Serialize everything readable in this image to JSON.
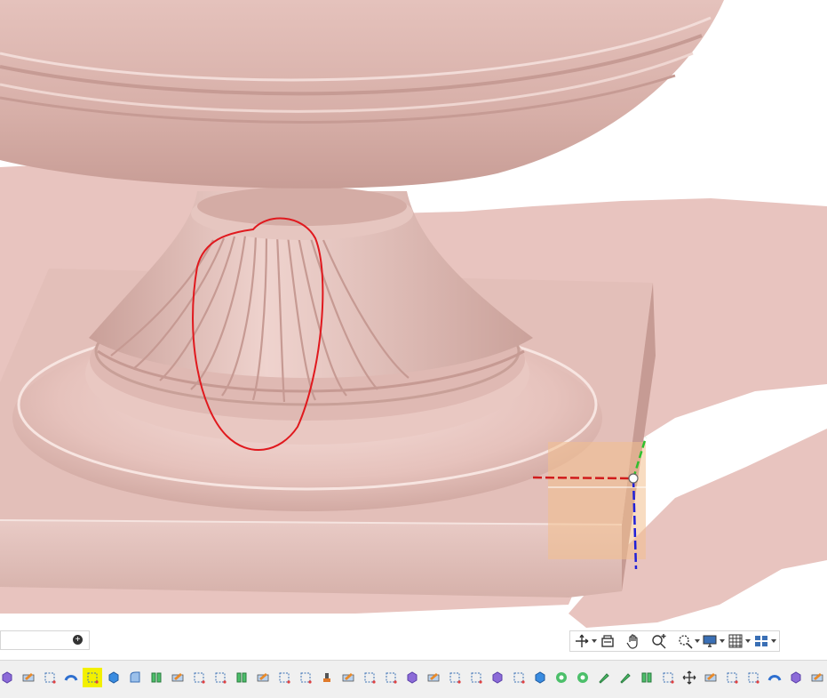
{
  "viewport": {
    "background": "#ffffff",
    "model_color": "#e8c4bf",
    "annotation_color": "#e0191e",
    "triad_colors": {
      "x_axis": "#d01c1c",
      "y_axis": "#2ec02e",
      "z_axis": "#2020d8"
    },
    "selection_color": "#f3c08e"
  },
  "panel_field": {
    "add_icon": "plus-circle-icon"
  },
  "view_toolbar": {
    "buttons": [
      {
        "icon": "orient-axes-icon",
        "has_menu": true
      },
      {
        "icon": "section-view-icon",
        "has_menu": false
      },
      {
        "icon": "pan-hand-icon",
        "has_menu": false
      },
      {
        "icon": "zoom-in-icon",
        "has_menu": false
      },
      {
        "icon": "zoom-fit-icon",
        "has_menu": true
      },
      {
        "icon": "display-monitor-icon",
        "has_menu": true
      },
      {
        "icon": "grid-icon",
        "has_menu": true
      },
      {
        "icon": "layout-icon",
        "has_menu": true
      }
    ]
  },
  "command_toolbar": {
    "active_index": 4,
    "active_color": "#f3f000",
    "buttons": [
      "cube-purple-icon",
      "pencil-box-icon",
      "sketch-box-icon",
      "blue-arc-icon",
      "sketch-box-icon",
      "blue-cube-icon",
      "blue-sweep-icon",
      "green-split-icon",
      "pencil-box-icon",
      "sketch-box-icon",
      "sketch-box-icon",
      "green-split-icon",
      "pencil-box-icon",
      "sketch-box-icon",
      "sketch-box-icon",
      "stamp-icon",
      "pencil-box-icon",
      "sketch-box-icon",
      "sketch-box-icon",
      "cube-purple-icon",
      "pencil-box-icon",
      "sketch-box-icon",
      "sketch-box-icon",
      "cube-purple-icon",
      "sketch-box-icon",
      "blue-cube-icon",
      "green-target-icon",
      "green-target-icon",
      "green-pen-icon",
      "green-pen-icon",
      "green-split-icon",
      "sketch-box-icon",
      "move-arrows-icon",
      "pencil-box-icon",
      "sketch-box-icon",
      "sketch-box-icon",
      "blue-arc-icon",
      "cube-purple-icon",
      "pencil-box-icon"
    ]
  }
}
